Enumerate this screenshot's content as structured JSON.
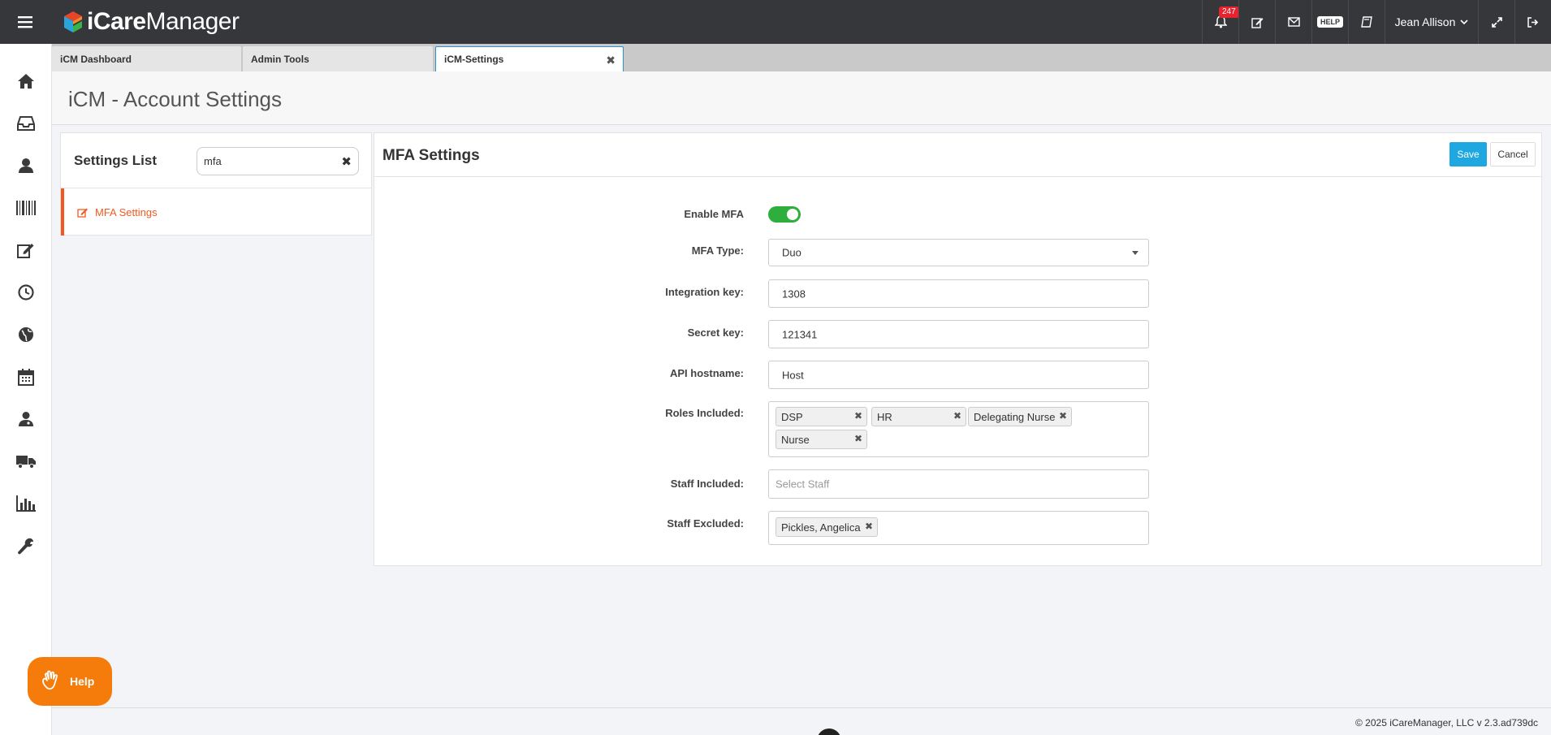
{
  "topbar": {
    "logo_text_bold": "iCare",
    "logo_text_regular": "Manager",
    "notification_count": "247",
    "help_label": "HELP",
    "user_name": "Jean Allison"
  },
  "tabs": [
    {
      "label": "iCM Dashboard"
    },
    {
      "label": "Admin Tools"
    },
    {
      "label": "iCM-Settings"
    }
  ],
  "page": {
    "title": "iCM - Account Settings"
  },
  "settings_list": {
    "title": "Settings List",
    "search_value": "mfa",
    "items": [
      {
        "label": "MFA Settings"
      }
    ]
  },
  "mfa": {
    "title": "MFA Settings",
    "save_label": "Save",
    "cancel_label": "Cancel",
    "labels": {
      "enable": "Enable MFA",
      "type": "MFA Type:",
      "integration_key": "Integration key:",
      "secret_key": "Secret key:",
      "api_hostname": "API hostname:",
      "roles_included": "Roles Included:",
      "staff_included": "Staff Included:",
      "staff_excluded": "Staff Excluded:"
    },
    "enabled": true,
    "type_value": "Duo",
    "integration_key_value": "1308",
    "secret_key_value": "121341",
    "api_hostname_value": "Host",
    "roles": [
      "DSP",
      "HR",
      "Delegating Nurse",
      "Nurse"
    ],
    "staff_included_placeholder": "Select Staff",
    "staff_excluded": [
      "Pickles, Angelica"
    ]
  },
  "help_widget": {
    "label": "Help"
  },
  "footer": {
    "copyright": "© 2025 iCareManager, LLC v 2.3.ad739dc"
  },
  "colors": {
    "topbar": "#36373b",
    "accent_orange": "#f05a22",
    "save_blue": "#1ea7e1",
    "toggle_green": "#2eae3c",
    "help_orange": "#f57c0a"
  }
}
